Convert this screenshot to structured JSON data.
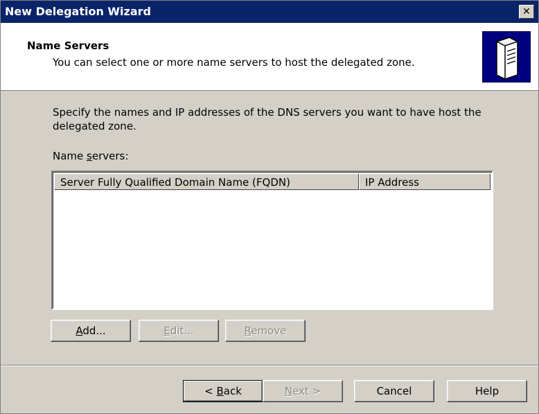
{
  "window": {
    "title": "New Delegation Wizard",
    "close_glyph": "✕"
  },
  "header": {
    "title": "Name Servers",
    "subtitle": "You can select one or more name servers to host the delegated zone.",
    "icon": "server-icon"
  },
  "content": {
    "description": "Specify the names and IP addresses of the DNS servers you want to have host the delegated zone.",
    "name_servers_label_pre": "Name ",
    "name_servers_label_ul": "s",
    "name_servers_label_post": "ervers:",
    "columns": [
      "Server Fully Qualified Domain Name (FQDN)",
      "IP Address"
    ],
    "rows": []
  },
  "list_buttons": {
    "add": {
      "ul": "A",
      "rest": "dd...",
      "enabled": true
    },
    "edit": {
      "ul": "E",
      "rest": "dit...",
      "enabled": false
    },
    "remove": {
      "ul": "R",
      "rest": "emove",
      "enabled": false
    }
  },
  "nav_buttons": {
    "back": {
      "pre": "< ",
      "ul": "B",
      "rest": "ack",
      "enabled": true
    },
    "next": {
      "ul": "N",
      "rest": "ext >",
      "enabled": false
    },
    "cancel": "Cancel",
    "help": "Help"
  }
}
